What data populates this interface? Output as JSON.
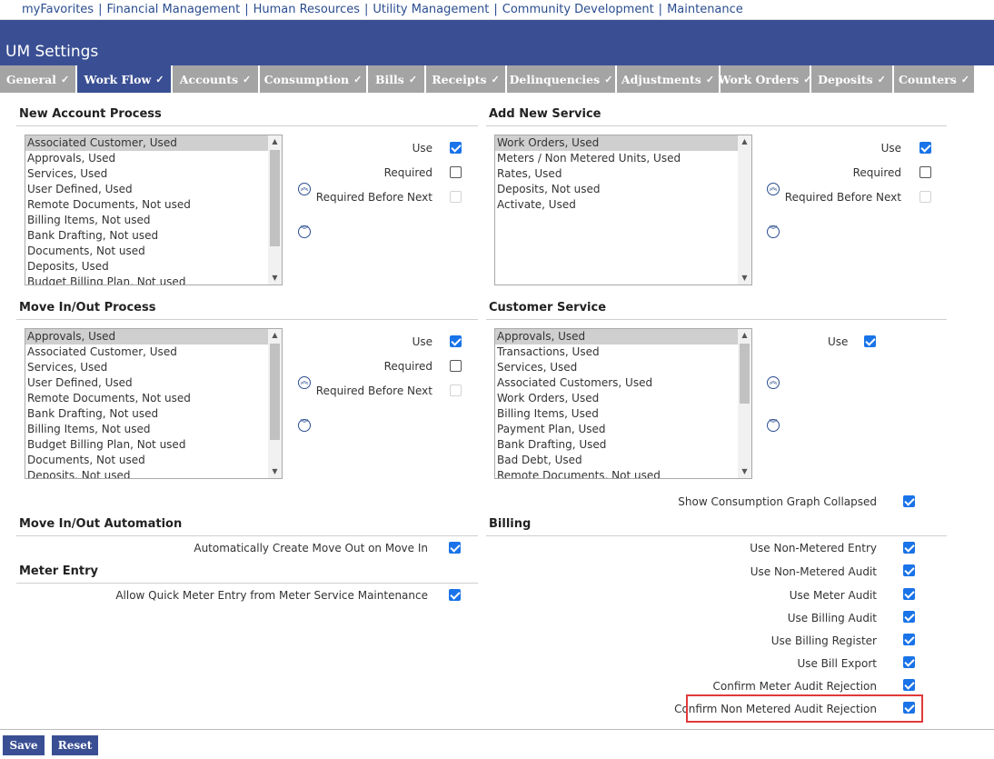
{
  "topnav": {
    "links": [
      "myFavorites",
      "Financial Management",
      "Human Resources",
      "Utility Management",
      "Community Development",
      "Maintenance"
    ],
    "separator": "|"
  },
  "header": {
    "title": "UM Settings"
  },
  "tabs": [
    {
      "label": "General",
      "active": false
    },
    {
      "label": "Work Flow",
      "active": true
    },
    {
      "label": "Accounts",
      "active": false
    },
    {
      "label": "Consumption",
      "active": false
    },
    {
      "label": "Bills",
      "active": false
    },
    {
      "label": "Receipts",
      "active": false
    },
    {
      "label": "Delinquencies",
      "active": false
    },
    {
      "label": "Adjustments",
      "active": false
    },
    {
      "label": "Work Orders",
      "active": false
    },
    {
      "label": "Deposits",
      "active": false
    },
    {
      "label": "Counters",
      "active": false
    }
  ],
  "check_glyph": "✓",
  "move_up_glyph": "︽",
  "move_down_glyph": "︾",
  "sections": {
    "new_account": {
      "title": "New Account Process",
      "items": [
        "Associated Customer, Used",
        "Approvals, Used",
        "Services, Used",
        "User Defined, Used",
        "Remote Documents, Not used",
        "Billing Items, Not used",
        "Bank Drafting, Not used",
        "Documents, Not used",
        "Deposits, Used",
        "Budget Billing Plan, Not used"
      ],
      "selected_index": 0,
      "use_label": "Use",
      "use_checked": true,
      "required_label": "Required",
      "required_checked": false,
      "required_before_next_label": "Required Before Next",
      "required_before_next_checked": false
    },
    "add_new_service": {
      "title": "Add New Service",
      "items": [
        "Work Orders, Used",
        "Meters / Non Metered Units, Used",
        "Rates, Used",
        "Deposits, Not used",
        "Activate, Used"
      ],
      "selected_index": 0,
      "use_label": "Use",
      "use_checked": true,
      "required_label": "Required",
      "required_checked": false,
      "required_before_next_label": "Required Before Next",
      "required_before_next_checked": false
    },
    "move_in_out": {
      "title": "Move In/Out Process",
      "items": [
        "Approvals, Used",
        "Associated Customer, Used",
        "Services, Used",
        "User Defined, Used",
        "Remote Documents, Not used",
        "Bank Drafting, Not used",
        "Billing Items, Not used",
        "Budget Billing Plan, Not used",
        "Documents, Not used",
        "Deposits, Not used"
      ],
      "selected_index": 0,
      "use_label": "Use",
      "use_checked": true,
      "required_label": "Required",
      "required_checked": false,
      "required_before_next_label": "Required Before Next",
      "required_before_next_checked": false
    },
    "customer_service": {
      "title": "Customer Service",
      "items": [
        "Approvals, Used",
        "Transactions, Used",
        "Services, Used",
        "Associated Customers, Used",
        "Work Orders, Used",
        "Billing Items, Used",
        "Payment Plan, Used",
        "Bank Drafting, Used",
        "Bad Debt, Used",
        "Remote Documents, Not used"
      ],
      "selected_index": 0,
      "use_label": "Use",
      "use_checked": true
    },
    "show_consumption": {
      "label": "Show Consumption Graph Collapsed",
      "checked": true
    },
    "move_automation": {
      "title": "Move In/Out Automation",
      "option": {
        "label": "Automatically Create Move Out on Move In",
        "checked": true
      }
    },
    "meter_entry": {
      "title": "Meter Entry",
      "option": {
        "label": "Allow Quick Meter Entry from Meter Service Maintenance",
        "checked": true
      }
    },
    "billing": {
      "title": "Billing",
      "options": [
        {
          "label": "Use Non-Metered Entry",
          "checked": true
        },
        {
          "label": "Use Non-Metered Audit",
          "checked": true
        },
        {
          "label": "Use Meter Audit",
          "checked": true
        },
        {
          "label": "Use Billing Audit",
          "checked": true
        },
        {
          "label": "Use Billing Register",
          "checked": true
        },
        {
          "label": "Use Bill Export",
          "checked": true
        },
        {
          "label": "Confirm Meter Audit Rejection",
          "checked": true
        },
        {
          "label": "Confirm Non Metered Audit Rejection",
          "checked": true
        }
      ],
      "highlighted_index": 7
    }
  },
  "buttons": {
    "save": "Save",
    "reset": "Reset"
  },
  "colors": {
    "header": "#3a4f93",
    "tab_inactive": "#a4a4a4",
    "checkbox": "#1a73e8",
    "highlight": "#e03a3a"
  }
}
